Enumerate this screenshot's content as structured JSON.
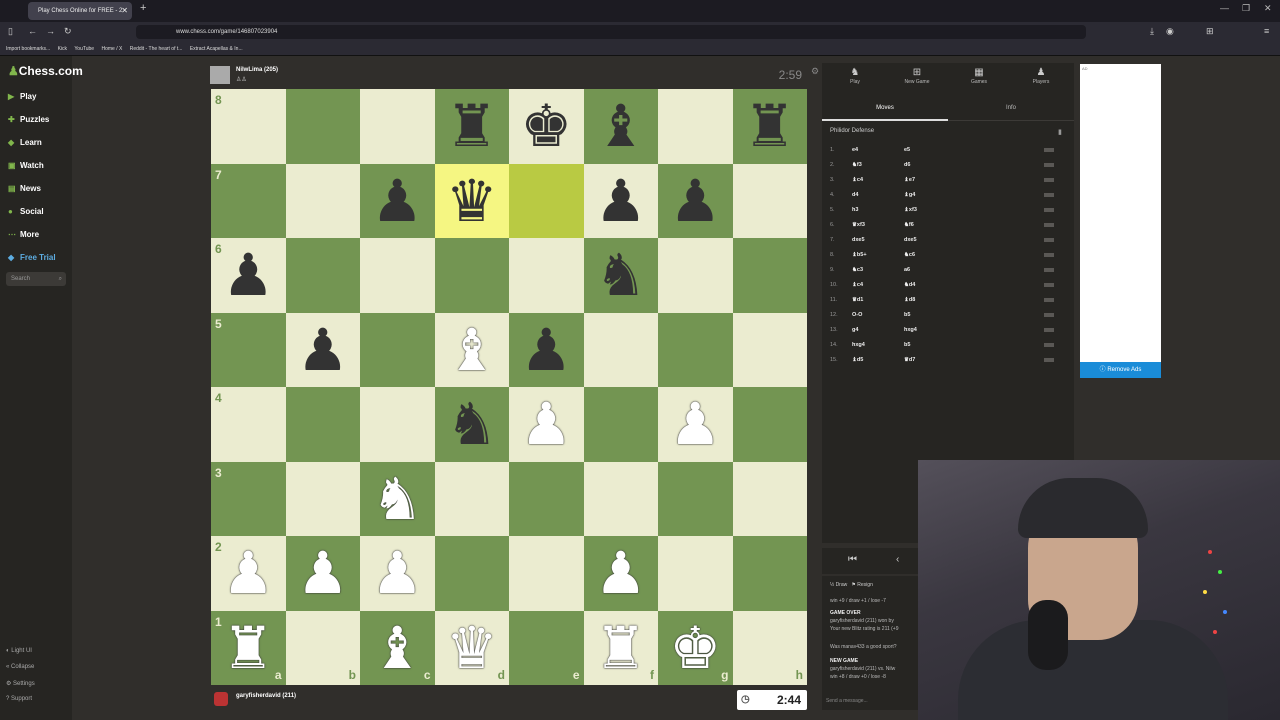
{
  "browser": {
    "tab_title": "Play Chess Online for FREE - 2",
    "url": "www.chess.com/game/146807023904",
    "bookmarks": [
      "Import bookmarks...",
      "Kick",
      "YouTube",
      "Home / X",
      "Reddit - The heart of t...",
      "Extract Acapellas & In..."
    ]
  },
  "sidebar": {
    "logo": "Chess.com",
    "items": [
      {
        "label": "Play",
        "icon": "play-icon"
      },
      {
        "label": "Puzzles",
        "icon": "puzzle-icon"
      },
      {
        "label": "Learn",
        "icon": "learn-icon"
      },
      {
        "label": "Watch",
        "icon": "watch-icon"
      },
      {
        "label": "News",
        "icon": "news-icon"
      },
      {
        "label": "Social",
        "icon": "social-icon"
      },
      {
        "label": "More",
        "icon": "more-icon"
      },
      {
        "label": "Free Trial",
        "icon": "diamond-icon"
      }
    ],
    "search_placeholder": "Search",
    "bottom": [
      "Light UI",
      "Collapse",
      "Settings",
      "Support"
    ]
  },
  "top_player": {
    "name": "NilwLima (205)",
    "clock": "2:59"
  },
  "bottom_player": {
    "name": "garyfisherdavid (211)",
    "clock": "2:44"
  },
  "board": {
    "ranks": [
      "8",
      "7",
      "6",
      "5",
      "4",
      "3",
      "2",
      "1"
    ],
    "files": [
      "a",
      "b",
      "c",
      "d",
      "e",
      "f",
      "g",
      "h"
    ],
    "position": [
      [
        "",
        "",
        "",
        "br",
        "bk",
        "bb",
        "",
        "br"
      ],
      [
        "",
        "",
        "bp",
        "bq",
        "",
        "bp",
        "bp",
        ""
      ],
      [
        "bp",
        "",
        "",
        "",
        "",
        "bn",
        "",
        ""
      ],
      [
        "",
        "bp",
        "",
        "wb",
        "bp",
        "",
        "",
        ""
      ],
      [
        "",
        "",
        "",
        "bn",
        "wp",
        "",
        "wp",
        ""
      ],
      [
        "",
        "",
        "wn",
        "",
        "",
        "",
        "",
        ""
      ],
      [
        "wp",
        "wp",
        "wp",
        "",
        "",
        "wp",
        "",
        ""
      ],
      [
        "wr",
        "",
        "wb",
        "wq",
        "",
        "wr",
        "wk",
        ""
      ]
    ],
    "highlight": [
      "d7",
      "e7"
    ],
    "colors": {
      "light": "#ebecd0",
      "dark": "#739552",
      "highlight_from": "#b9ca43",
      "highlight_to": "#f5f682"
    }
  },
  "panel": {
    "tabs": [
      {
        "label": "Play",
        "icon": "play-icon"
      },
      {
        "label": "New Game",
        "icon": "plus-icon"
      },
      {
        "label": "Games",
        "icon": "games-icon"
      },
      {
        "label": "Players",
        "icon": "players-icon"
      }
    ],
    "subtabs": {
      "moves": "Moves",
      "info": "Info"
    },
    "opening": "Philidor Defense",
    "moves": [
      {
        "n": "1.",
        "w": "e4",
        "b": "e5"
      },
      {
        "n": "2.",
        "w": "♞f3",
        "b": "d6"
      },
      {
        "n": "3.",
        "w": "♝c4",
        "b": "♝e7"
      },
      {
        "n": "4.",
        "w": "d4",
        "b": "♝g4"
      },
      {
        "n": "5.",
        "w": "h3",
        "b": "♝xf3"
      },
      {
        "n": "6.",
        "w": "♛xf3",
        "b": "♞f6"
      },
      {
        "n": "7.",
        "w": "dxe5",
        "b": "dxe5"
      },
      {
        "n": "8.",
        "w": "♝b5+",
        "b": "♞c6"
      },
      {
        "n": "9.",
        "w": "♞c3",
        "b": "a6"
      },
      {
        "n": "10.",
        "w": "♝c4",
        "b": "♞d4"
      },
      {
        "n": "11.",
        "w": "♛d1",
        "b": "♝d8"
      },
      {
        "n": "12.",
        "w": "O-O",
        "b": "b5"
      },
      {
        "n": "13.",
        "w": "g4",
        "b": "hxg4"
      },
      {
        "n": "14.",
        "w": "hxg4",
        "b": "b5"
      },
      {
        "n": "15.",
        "w": "♝d5",
        "b": "♛d7"
      }
    ]
  },
  "ad": {
    "label": "AD",
    "remove": "Remove Ads"
  },
  "chat": {
    "draw": "Draw",
    "resign": "Resign",
    "lines": [
      "win +9 / draw +1 / lose -7",
      "GAME OVER",
      "garyfisherdavid (211) won by",
      "Your new Blitz rating is 211 (+9",
      "Was manav433 a good sport?",
      "NEW GAME",
      "garyfisherdavid (211) vs. Nilw",
      "win +8 / draw +0 / lose -8"
    ],
    "send_placeholder": "Send a message..."
  }
}
